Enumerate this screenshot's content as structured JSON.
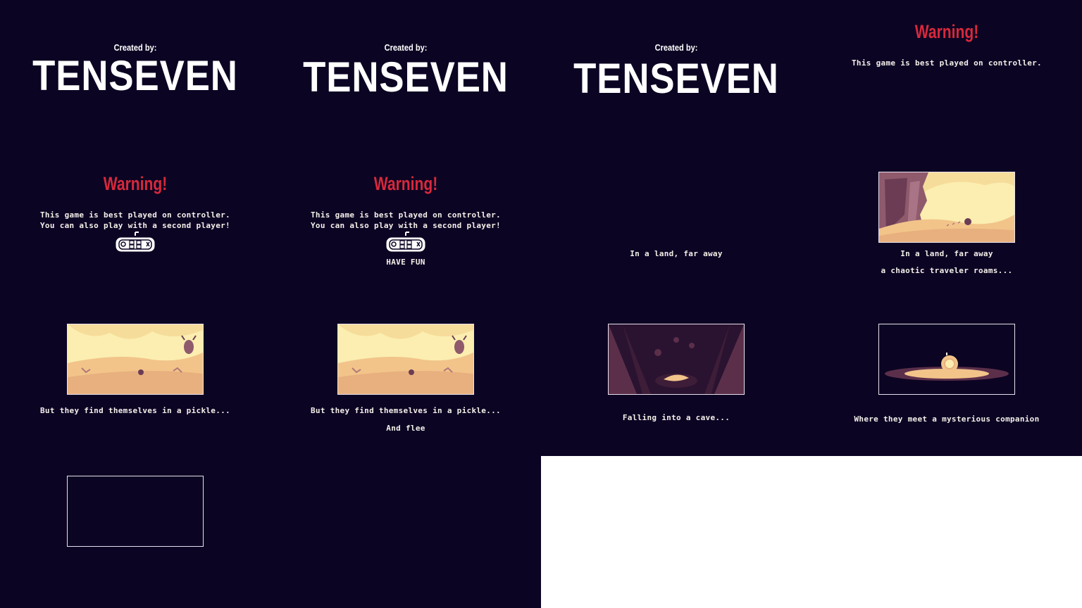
{
  "credits": {
    "created_by": "Created by:",
    "studio": "TENSEVEN"
  },
  "warning": {
    "title": "Warning!",
    "line1": "This game is best played on controller.",
    "line2": "You can also play with a second player!",
    "have_fun": "HAVE FUN"
  },
  "story": {
    "land": "In a land, far away",
    "traveler": "a chaotic traveler roams...",
    "pickle": "But they find themselves in a pickle...",
    "flee": "And flee",
    "cave": "Falling into a cave...",
    "companion": "Where they meet a mysterious companion"
  },
  "colors": {
    "background": "#0c0423",
    "warning": "#d8283c",
    "text": "#f4f0ea",
    "sand": "#f2c48a",
    "sky": "#fbeeb0",
    "cave": "#5b2f4a"
  },
  "icons": [
    "gamepad-icon"
  ]
}
